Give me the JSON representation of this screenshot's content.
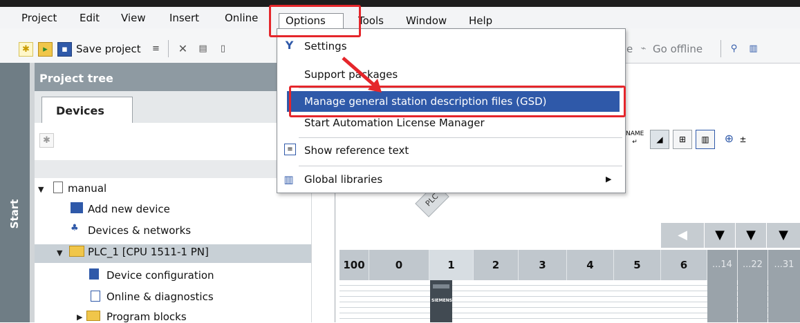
{
  "menubar": {
    "items": [
      "Project",
      "Edit",
      "View",
      "Insert",
      "Online",
      "Options",
      "Tools",
      "Window",
      "Help"
    ]
  },
  "toolbar": {
    "save_label": "Save project",
    "go_online_label": "e",
    "go_offline_label": "Go offline"
  },
  "options_menu": {
    "items": [
      {
        "label": "Settings",
        "icon": "settings-icon"
      },
      {
        "label": "Support packages"
      },
      {
        "label": "Manage general station description files (GSD)"
      },
      {
        "label": "Start Automation License Manager"
      },
      {
        "label": "Show reference text",
        "icon": "reference-text-icon"
      },
      {
        "label": "Global libraries",
        "icon": "library-icon",
        "submenu_arrow": "▶"
      }
    ]
  },
  "sidebar": {
    "start_label": "Start"
  },
  "project_tree": {
    "title": "Project tree",
    "tab_label": "Devices",
    "items": [
      {
        "label": "manual"
      },
      {
        "label": "Add new device"
      },
      {
        "label": "Devices & networks"
      },
      {
        "label": "PLC_1 [CPU 1511-1 PN]"
      },
      {
        "label": "Device configuration"
      },
      {
        "label": "Online & diagnostics"
      },
      {
        "label": "Program blocks"
      }
    ]
  },
  "device_view": {
    "plc_tag": "PLC",
    "slots": [
      "100",
      "0",
      "1",
      "2",
      "3",
      "4",
      "5",
      "6",
      "...14",
      "...22",
      "...31"
    ],
    "module_brand": "SIEMENS"
  },
  "colors": {
    "highlight": "#2f59a9",
    "annotation_red": "#e5262b",
    "start_bar": "#6f7d85"
  }
}
